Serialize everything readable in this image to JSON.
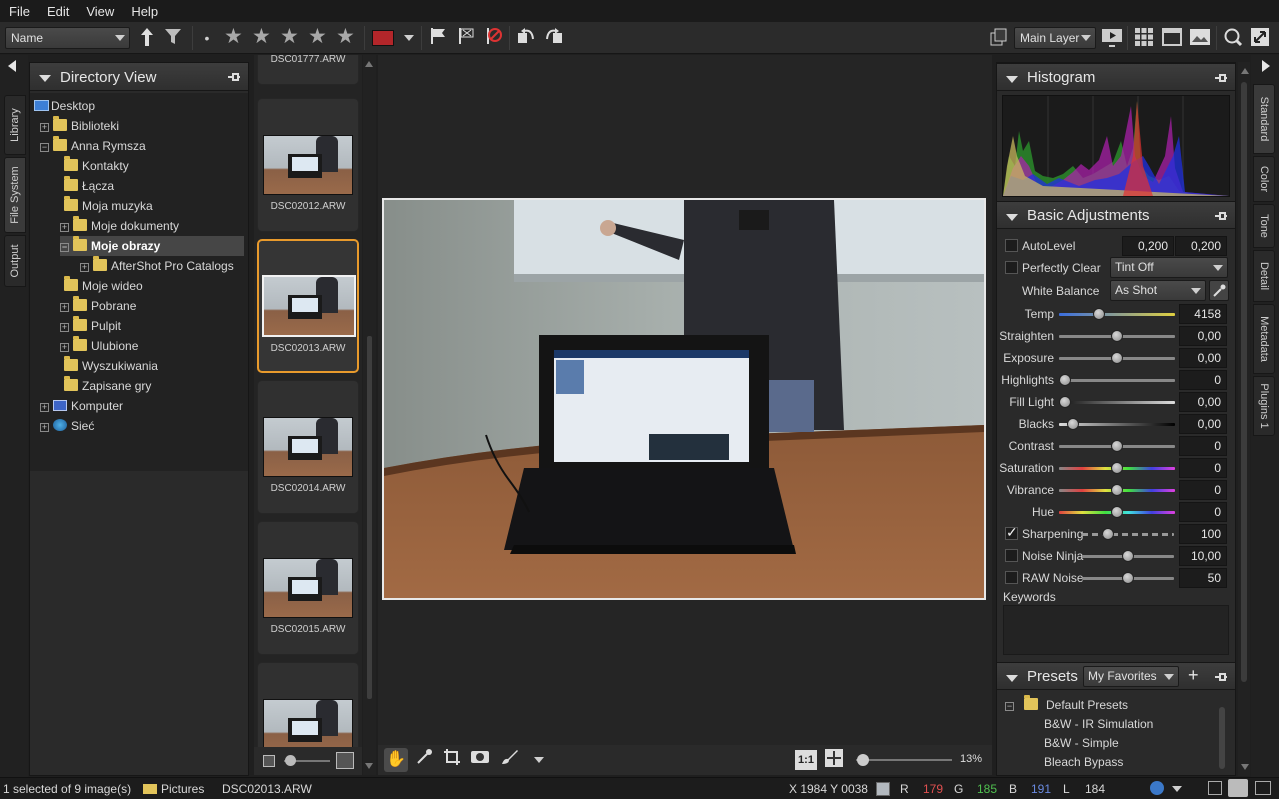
{
  "menu": [
    "File",
    "Edit",
    "View",
    "Help"
  ],
  "toolbar": {
    "sort_select": "Name",
    "layer_select": "Main Layer"
  },
  "left_tabs": [
    "Library",
    "File System",
    "Output"
  ],
  "directory": {
    "title": "Directory View",
    "nodes": [
      {
        "label": "Desktop"
      },
      {
        "label": "Biblioteki"
      },
      {
        "label": "Anna Rymsza"
      },
      {
        "label": "Kontakty"
      },
      {
        "label": "Łącza"
      },
      {
        "label": "Moja muzyka"
      },
      {
        "label": "Moje dokumenty"
      },
      {
        "label": "Moje obrazy"
      },
      {
        "label": "AfterShot Pro Catalogs"
      },
      {
        "label": "Moje wideo"
      },
      {
        "label": "Pobrane"
      },
      {
        "label": "Pulpit"
      },
      {
        "label": "Ulubione"
      },
      {
        "label": "Wyszukiwania"
      },
      {
        "label": "Zapisane gry"
      },
      {
        "label": "Komputer"
      },
      {
        "label": "Sieć"
      }
    ]
  },
  "thumbnails": [
    {
      "name": "DSC01777.ARW"
    },
    {
      "name": "DSC02012.ARW"
    },
    {
      "name": "DSC02013.ARW"
    },
    {
      "name": "DSC02014.ARW"
    },
    {
      "name": "DSC02015.ARW"
    }
  ],
  "right_tabs": [
    "Standard",
    "Color",
    "Tone",
    "Detail",
    "Metadata",
    "Plugins 1"
  ],
  "histogram": {
    "title": "Histogram"
  },
  "basic": {
    "title": "Basic Adjustments",
    "autolevel": {
      "label": "AutoLevel",
      "v1": "0,200",
      "v2": "0,200"
    },
    "perfectly_clear": {
      "label": "Perfectly Clear",
      "select": "Tint Off"
    },
    "white_balance": {
      "label": "White Balance",
      "select": "As Shot"
    },
    "sliders": [
      {
        "label": "Temp",
        "value": "4158",
        "pos": 0.33
      },
      {
        "label": "Straighten",
        "value": "0,00",
        "pos": 0.5
      },
      {
        "label": "Exposure",
        "value": "0,00",
        "pos": 0.5
      },
      {
        "label": "Highlights",
        "value": "0",
        "pos": 0.0
      },
      {
        "label": "Fill Light",
        "value": "0,00",
        "pos": 0.0
      },
      {
        "label": "Blacks",
        "value": "0,00",
        "pos": 0.08
      },
      {
        "label": "Contrast",
        "value": "0",
        "pos": 0.5
      },
      {
        "label": "Saturation",
        "value": "0",
        "pos": 0.5
      },
      {
        "label": "Vibrance",
        "value": "0",
        "pos": 0.5
      },
      {
        "label": "Hue",
        "value": "0",
        "pos": 0.5
      }
    ],
    "sharpening": {
      "label": "Sharpening",
      "value": "100"
    },
    "noise_ninja": {
      "label": "Noise Ninja",
      "value": "10,00"
    },
    "raw_noise": {
      "label": "RAW Noise",
      "value": "50"
    },
    "keywords_label": "Keywords"
  },
  "presets": {
    "title": "Presets",
    "select": "My Favorites",
    "group": "Default Presets",
    "items": [
      "B&W - IR Simulation",
      "B&W - Simple",
      "Bleach Bypass"
    ]
  },
  "viewer": {
    "zoom_11": "1:1",
    "zoom_pct": "13%"
  },
  "status": {
    "selection": "1 selected of 9 image(s)",
    "folder": "Pictures",
    "file": "DSC02013.ARW",
    "coords": "X 1984  Y 0038",
    "r_label": "R",
    "r_value": "179",
    "g_label": "G",
    "g_value": "185",
    "b_label": "B",
    "b_value": "191",
    "l_label": "L",
    "l_value": "184"
  }
}
